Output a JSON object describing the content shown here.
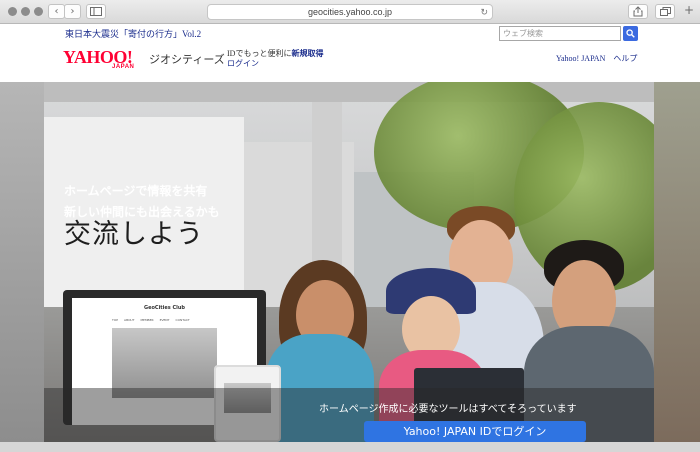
{
  "browser": {
    "url": "geocities.yahoo.co.jp",
    "back_label": "‹",
    "forward_label": "›",
    "reload_label": "↻"
  },
  "header": {
    "notice": "東日本大震災「寄付の行方」Vol.2",
    "search_placeholder": "ウェブ検索",
    "logo_text": "YAHOO!",
    "logo_sub": "JAPAN",
    "service_name": "ジオシティーズ",
    "id_text": "IDでもっと便利に",
    "register_link": "新規取得",
    "login_link": "ログイン",
    "yahoo_japan_link": "Yahoo! JAPAN",
    "help_link": "ヘルプ"
  },
  "hero": {
    "title": "交流しよう",
    "subtitle_line1": "ホームページで情報を共有",
    "subtitle_line2": "新しい仲間にも出会えるかも",
    "tools_text": "ホームページ作成に必要なツールはすべてそろっています",
    "login_button": "Yahoo! JAPAN IDでログイン",
    "device_site_title": "GeoCities Club",
    "device_nav": [
      "TOP",
      "ABOUT",
      "MEMBER",
      "EVENT",
      "CONTACT"
    ]
  },
  "colors": {
    "accent": "#2f74e2",
    "yahoo_red": "#ff0033",
    "link": "#1a2c8c"
  }
}
